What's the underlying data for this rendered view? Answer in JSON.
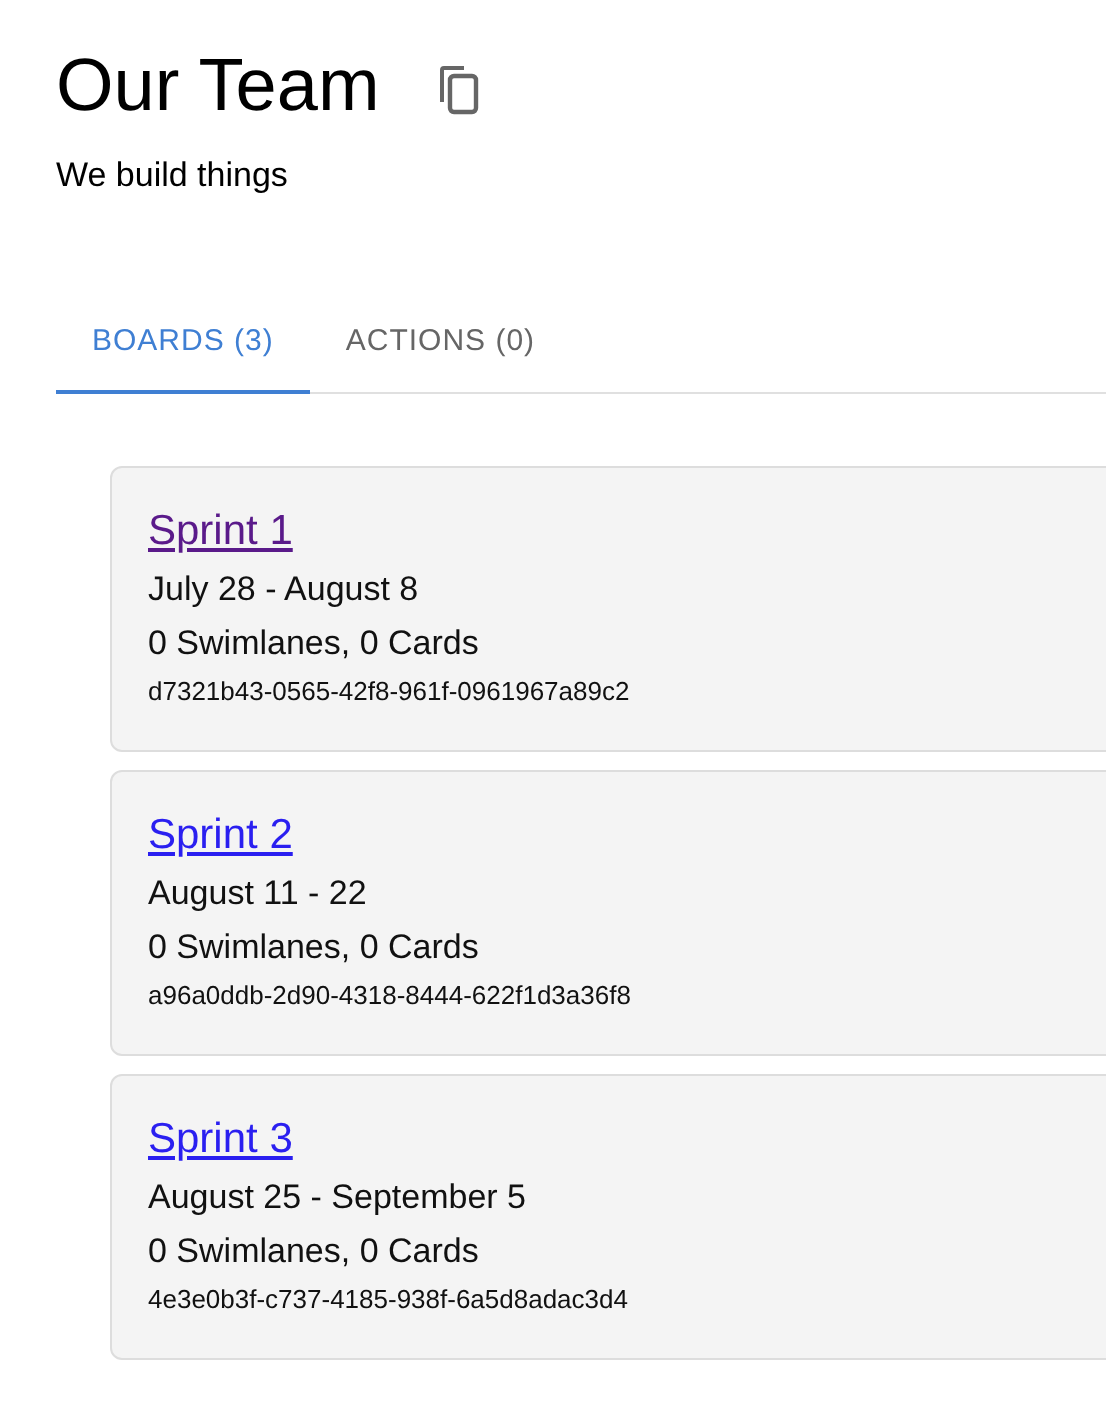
{
  "header": {
    "title": "Our Team",
    "subtitle": "We build things"
  },
  "tabs": [
    {
      "label": "BOARDS (3)",
      "selected": true
    },
    {
      "label": "ACTIONS (0)",
      "selected": false
    }
  ],
  "boards": [
    {
      "name": "Sprint 1",
      "visited": true,
      "dates": "July 28 - August 8",
      "summary": "0 Swimlanes, 0 Cards",
      "id": "d7321b43-0565-42f8-961f-0961967a89c2"
    },
    {
      "name": "Sprint 2",
      "visited": false,
      "dates": "August 11 - 22",
      "summary": "0 Swimlanes, 0 Cards",
      "id": "a96a0ddb-2d90-4318-8444-622f1d3a36f8"
    },
    {
      "name": "Sprint 3",
      "visited": false,
      "dates": "August 25 - September 5",
      "summary": "0 Swimlanes, 0 Cards",
      "id": "4e3e0b3f-c737-4185-938f-6a5d8adac3d4"
    }
  ]
}
